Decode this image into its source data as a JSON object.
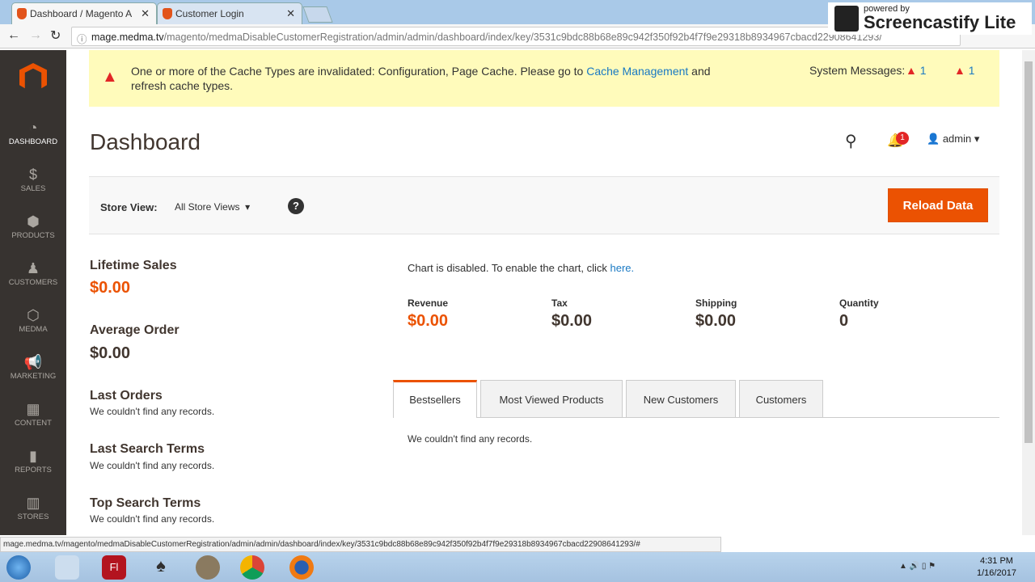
{
  "browser": {
    "tabs": [
      {
        "label": "Dashboard / Magento A"
      },
      {
        "label": "Customer Login"
      }
    ],
    "url_host": "mage.medma.tv",
    "url_path": "/magento/medmaDisableCustomerRegistration/admin/admin/dashboard/index/key/3531c9bdc88b68e89c942f350f92b4f7f9e29318b8934967cbacd22908641293/",
    "status_url": "mage.medma.tv/magento/medmaDisableCustomerRegistration/admin/admin/dashboard/index/key/3531c9bdc88b68e89c942f350f92b4f7f9e29318b8934967cbacd22908641293/#"
  },
  "watermark": {
    "line1": "powered by",
    "line2": "Screencastify Lite"
  },
  "sidebar": {
    "items": [
      {
        "label": "DASHBOARD"
      },
      {
        "label": "SALES"
      },
      {
        "label": "PRODUCTS"
      },
      {
        "label": "CUSTOMERS"
      },
      {
        "label": "MEDMA"
      },
      {
        "label": "MARKETING"
      },
      {
        "label": "CONTENT"
      },
      {
        "label": "REPORTS"
      },
      {
        "label": "STORES"
      }
    ]
  },
  "message": {
    "text1": "One or more of the Cache Types are invalidated: Configuration, Page Cache. Please go to ",
    "link": "Cache Management",
    "text2": " and refresh cache types.",
    "system_label": "System Messages:",
    "count1": "1",
    "count2": "1"
  },
  "header": {
    "title": "Dashboard",
    "notif_count": "1",
    "user": "admin"
  },
  "toolbar": {
    "store_label": "Store View:",
    "store_value": "All Store Views",
    "reload": "Reload Data"
  },
  "left": {
    "lifetime_label": "Lifetime Sales",
    "lifetime_value": "$0.00",
    "avg_label": "Average Order",
    "avg_value": "$0.00",
    "sections": [
      {
        "title": "Last Orders",
        "text": "We couldn't find any records."
      },
      {
        "title": "Last Search Terms",
        "text": "We couldn't find any records."
      },
      {
        "title": "Top Search Terms",
        "text": "We couldn't find any records."
      }
    ]
  },
  "chart": {
    "text": "Chart is disabled. To enable the chart, click ",
    "link": "here."
  },
  "totals": [
    {
      "label": "Revenue",
      "value": "$0.00"
    },
    {
      "label": "Tax",
      "value": "$0.00"
    },
    {
      "label": "Shipping",
      "value": "$0.00"
    },
    {
      "label": "Quantity",
      "value": "0"
    }
  ],
  "tabs": [
    {
      "label": "Bestsellers"
    },
    {
      "label": "Most Viewed Products"
    },
    {
      "label": "New Customers"
    },
    {
      "label": "Customers"
    }
  ],
  "tab_content": "We couldn't find any records.",
  "taskbar": {
    "time": "4:31 PM",
    "date": "1/16/2017"
  }
}
